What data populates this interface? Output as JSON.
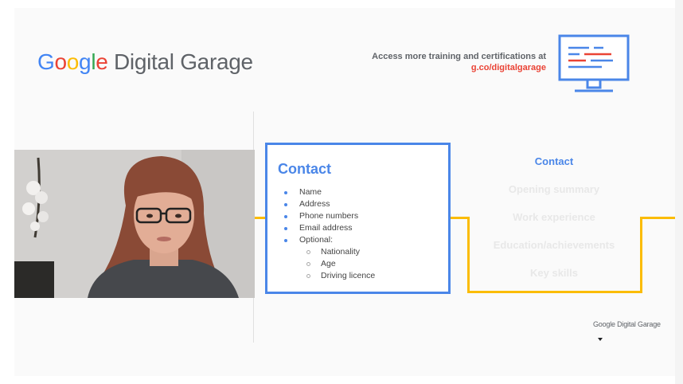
{
  "brand": {
    "logo_g1": "G",
    "logo_o1": "o",
    "logo_o2": "o",
    "logo_g2": "g",
    "logo_l": "l",
    "logo_e": "e",
    "name_rest": " Digital Garage"
  },
  "header": {
    "access_text": "Access more training and certifications at",
    "access_url": "g.co/digitalgarage"
  },
  "contact_card": {
    "title": "Contact",
    "items": [
      "Name",
      "Address",
      "Phone numbers",
      "Email address",
      "Optional:"
    ],
    "optional_items": [
      "Nationality",
      "Age",
      "Driving licence"
    ]
  },
  "cv_sections": {
    "items": [
      "Contact",
      "Opening summary",
      "Work experience",
      "Education/achievements",
      "Key skills"
    ],
    "active": "Contact"
  },
  "footer": {
    "small_brand": "Google Digital Garage"
  },
  "colors": {
    "google_blue": "#4285F4",
    "google_red": "#EA4335",
    "google_yellow": "#FBBC05",
    "google_green": "#34A853",
    "accent_blue": "#4a86e8",
    "timeline_yellow": "#FBBC05"
  },
  "icons": {
    "monitor": "computer-monitor-icon",
    "cursor": "mouse-cursor-icon"
  }
}
